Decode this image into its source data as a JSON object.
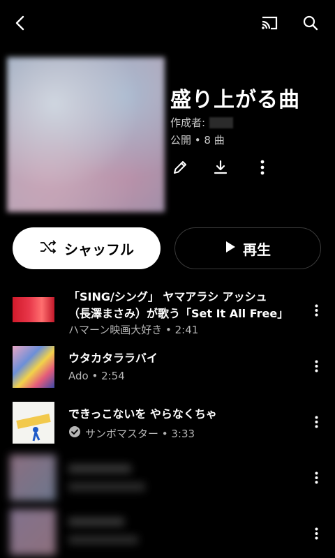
{
  "header": {
    "back_icon": "back-arrow-icon",
    "cast_icon": "cast-icon",
    "search_icon": "search-icon"
  },
  "playlist": {
    "title": "盛り上がる曲",
    "creator_label": "作成者:",
    "meta": "公開 • 8 曲"
  },
  "buttons": {
    "shuffle": "シャッフル",
    "play": "再生"
  },
  "tracks": [
    {
      "title_line1": "「SING/シング」 ヤマアラシ アッシュ",
      "title_line2": "（長澤まさみ）が歌う「Set It All Free」",
      "subtitle": "ハマーン映画大好き • 2:41"
    },
    {
      "title": "ウタカタララバイ",
      "subtitle": "Ado • 2:54"
    },
    {
      "title": "できっこないを やらなくちゃ",
      "subtitle": "サンボマスター • 3:33",
      "verified": true
    }
  ],
  "colors": {
    "background": "#000000",
    "shuffle_bg": "#ffffff",
    "subtext": "#b5b5b5"
  }
}
